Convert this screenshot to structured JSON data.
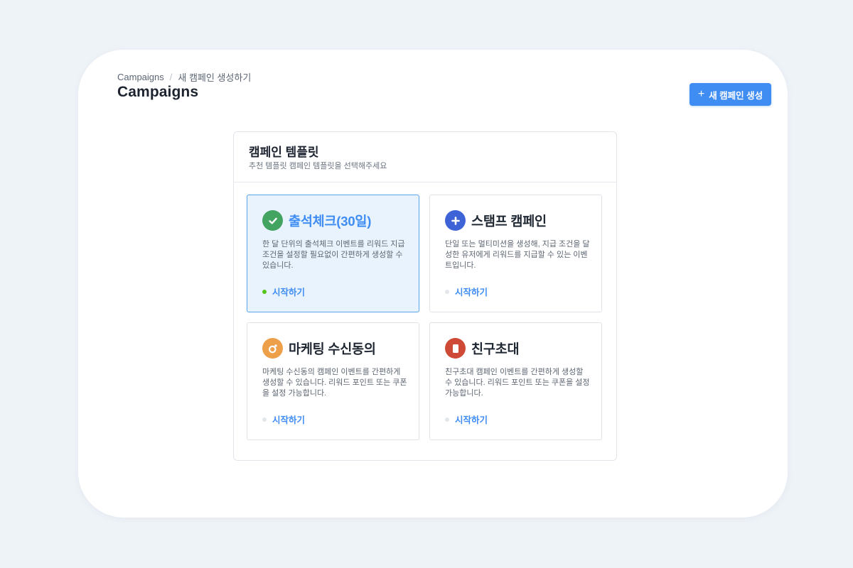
{
  "breadcrumb": {
    "root": "Campaigns",
    "separator": "/",
    "current": "새 캠페인 생성하기"
  },
  "header": {
    "title": "Campaigns",
    "new_button_icon": "plus-icon",
    "new_button_label": "새 캠페인 생성"
  },
  "panel": {
    "title": "캠페인 템플릿",
    "subtitle": "추천 템플릿 캠페인 템플릿을 선택해주세요"
  },
  "templates": [
    {
      "icon": "checkmark-icon",
      "title": "출석체크(30일)",
      "description": "한 달 단위의 출석체크 이벤트를 리워드 지급 조건을 설정할 필요없이 간편하게 생성할 수 있습니다.",
      "action": "시작하기",
      "selected": true
    },
    {
      "icon": "plus-icon",
      "title": "스탬프 캠페인",
      "description": "단일 또는 멀티미션을 생성해, 지급 조건을 달성한 유저에게 리워드를 지급할 수 있는 이벤트입니다.",
      "action": "시작하기",
      "selected": false
    },
    {
      "icon": "ring-icon",
      "title": "마케팅 수신동의",
      "description": "마케팅 수신동의 캠페인 이벤트를 간편하게 생성할 수 있습니다. 리워드 포인트 또는 쿠폰을 설정 가능합니다.",
      "action": "시작하기",
      "selected": false
    },
    {
      "icon": "card-icon",
      "title": "친구초대",
      "description": "친구초대 캠페인 이벤트를 간편하게 생성할 수 있습니다. 리워드 포인트 또는 쿠폰을 설정 가능합니다.",
      "action": "시작하기",
      "selected": false
    }
  ],
  "colors": {
    "background": "#eef3f8",
    "primary": "#3f8cf3",
    "selected_card_bg": "#e8f3fd",
    "check_icon": "#43a360",
    "plus_icon": "#3d63d6",
    "ring_icon": "#ee9f4a",
    "card_icon": "#cf4a36",
    "active_dot": "#52c41a"
  }
}
